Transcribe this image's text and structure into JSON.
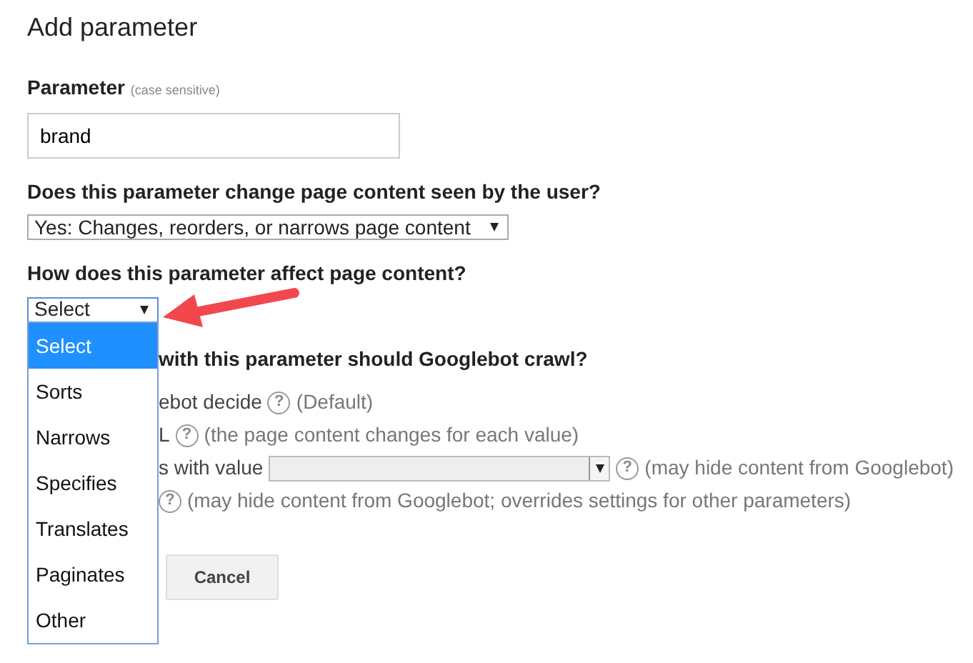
{
  "title": "Add parameter",
  "parameter": {
    "label": "Parameter",
    "hint": "(case sensitive)",
    "value": "brand"
  },
  "content_question": {
    "label": "Does this parameter change page content seen by the user?",
    "value": "Yes: Changes, reorders, or narrows page content"
  },
  "effect_question": {
    "label": "How does this parameter affect page content?",
    "value": "Select",
    "expanded": true,
    "options": [
      {
        "label": "Select",
        "selected": true
      },
      {
        "label": "Sorts",
        "selected": false
      },
      {
        "label": "Narrows",
        "selected": false
      },
      {
        "label": "Specifies",
        "selected": false
      },
      {
        "label": "Translates",
        "selected": false
      },
      {
        "label": "Paginates",
        "selected": false
      },
      {
        "label": "Other",
        "selected": false
      }
    ]
  },
  "crawl_question": {
    "label": "with this parameter should Googlebot crawl?",
    "choices": [
      {
        "kind": "plain",
        "label": "ebot decide",
        "help": "?",
        "note": "(Default)"
      },
      {
        "kind": "plain",
        "label": "L",
        "help": "?",
        "note": "(the page content changes for each value)"
      },
      {
        "kind": "value-select",
        "label": "s with value",
        "help": "?",
        "note": "(may hide content from Googlebot)"
      },
      {
        "kind": "plain",
        "help": "?",
        "note": "(may hide content from Googlebot; overrides settings for other parameters)"
      }
    ]
  },
  "cancel_button": "Cancel"
}
